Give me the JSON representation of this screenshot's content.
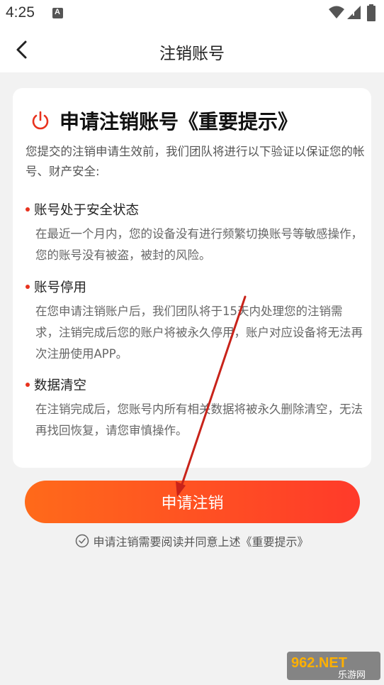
{
  "status_bar": {
    "time": "4:25"
  },
  "nav": {
    "title": "注销账号"
  },
  "card": {
    "heading": "申请注销账号《重要提示》",
    "intro": "您提交的注销申请生效前，我们团队将进行以下验证以保证您的帐号、财产安全:",
    "sections": [
      {
        "title": "账号处于安全状态",
        "body": "在最近一个月内，您的设备没有进行频繁切换账号等敏感操作，您的账号没有被盗，被封的风险。"
      },
      {
        "title": "账号停用",
        "body": "在您申请注销账户后，我们团队将于15天内处理您的注销需求，注销完成后您的账户将被永久停用，账户对应设备将无法再次注册使用APP。"
      },
      {
        "title": "数据清空",
        "body": "在注销完成后，您账号内所有相关数据将被永久删除清空，无法再找回恢复，请您审慎操作。"
      }
    ]
  },
  "apply_button": {
    "label": "申请注销"
  },
  "agreement": {
    "text": "申请注销需要阅读并同意上述《重要提示》"
  },
  "watermark": {
    "brand_text": "962.NET",
    "sub_text": "乐游网"
  },
  "colors": {
    "accent": "#ff4a24",
    "arrow": "#c8231a"
  },
  "icons": [
    "back-arrow-icon",
    "power-icon",
    "check-circle-icon",
    "wifi-icon",
    "signal-icon",
    "battery-icon"
  ]
}
